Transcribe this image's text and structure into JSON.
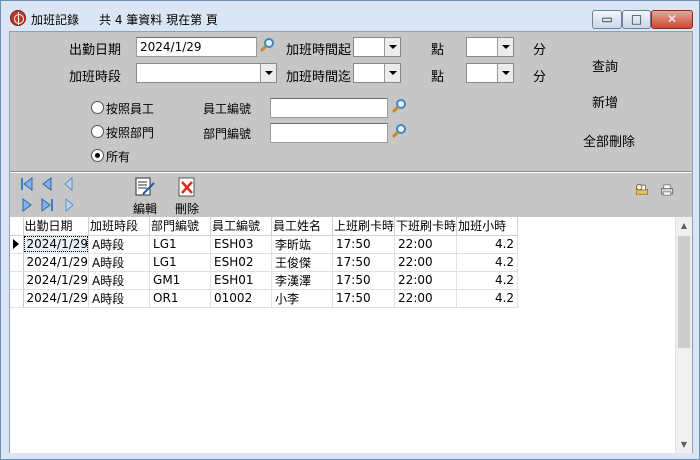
{
  "window": {
    "title": "加班記錄",
    "info": "共 4 筆資料  現在第 頁",
    "btn_min": "▭",
    "btn_max": "□",
    "btn_close": "✕"
  },
  "form": {
    "date_label": "出勤日期",
    "date_value": "2024/1/29",
    "shift_label": "加班時段",
    "shift_value": "",
    "start_label": "加班時間起",
    "end_label": "加班時間迄",
    "hour_unit": "點",
    "minute_unit": "分",
    "start_hour": "",
    "start_minute": "",
    "end_hour": "",
    "end_minute": "",
    "radio_by_employee": "按照員工",
    "radio_by_dept": "按照部門",
    "radio_all": "所有",
    "radio_selected": "所有",
    "employee_no_label": "員工編號",
    "employee_no_value": "",
    "dept_no_label": "部門編號",
    "dept_no_value": "",
    "btn_query": "查詢",
    "btn_add": "新增",
    "btn_delete_all": "全部刪除"
  },
  "toolbar": {
    "edit_label": "編輯",
    "delete_label": "刪除"
  },
  "grid": {
    "columns": [
      "出勤日期",
      "加班時段",
      "部門編號",
      "員工編號",
      "員工姓名",
      "上班刷卡時",
      "下班刷卡時",
      "加班小時"
    ],
    "rows": [
      [
        "2024/1/29",
        "A時段",
        "LG1",
        "ESH03",
        "李昕竑",
        "17:50",
        "22:00",
        "4.2"
      ],
      [
        "2024/1/29",
        "A時段",
        "LG1",
        "ESH02",
        "王俊傑",
        "17:50",
        "22:00",
        "4.2"
      ],
      [
        "2024/1/29",
        "A時段",
        "GM1",
        "ESH01",
        "李漢澤",
        "17:50",
        "22:00",
        "4.2"
      ],
      [
        "2024/1/29",
        "A時段",
        "OR1",
        "01002",
        "小李",
        "17:50",
        "22:00",
        "4.2"
      ]
    ]
  },
  "colors": {
    "panel": "#c6c6c6",
    "titlebar": "#dbe6f4",
    "close": "#c74a33"
  }
}
